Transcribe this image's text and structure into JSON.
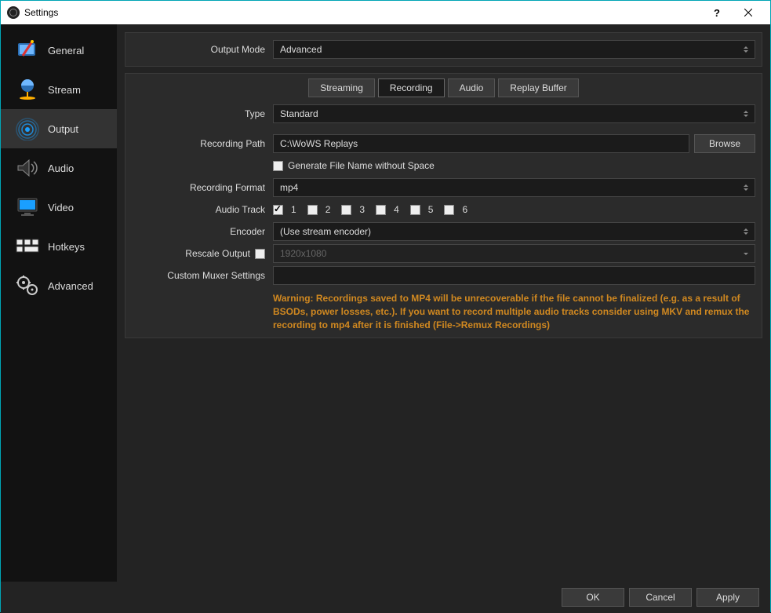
{
  "window": {
    "title": "Settings"
  },
  "sidebar": {
    "items": [
      {
        "label": "General"
      },
      {
        "label": "Stream"
      },
      {
        "label": "Output"
      },
      {
        "label": "Audio"
      },
      {
        "label": "Video"
      },
      {
        "label": "Hotkeys"
      },
      {
        "label": "Advanced"
      }
    ],
    "active_index": 2
  },
  "top": {
    "output_mode_label": "Output Mode",
    "output_mode_value": "Advanced"
  },
  "tabs": {
    "streaming": "Streaming",
    "recording": "Recording",
    "audio": "Audio",
    "replay_buffer": "Replay Buffer",
    "active": "recording"
  },
  "recording": {
    "type_label": "Type",
    "type_value": "Standard",
    "path_label": "Recording Path",
    "path_value": "C:\\WoWS Replays",
    "browse": "Browse",
    "gen_filename_checked": false,
    "gen_filename_label": "Generate File Name without Space",
    "format_label": "Recording Format",
    "format_value": "mp4",
    "audio_track_label": "Audio Track",
    "tracks": [
      {
        "num": "1",
        "checked": true
      },
      {
        "num": "2",
        "checked": false
      },
      {
        "num": "3",
        "checked": false
      },
      {
        "num": "4",
        "checked": false
      },
      {
        "num": "5",
        "checked": false
      },
      {
        "num": "6",
        "checked": false
      }
    ],
    "encoder_label": "Encoder",
    "encoder_value": "(Use stream encoder)",
    "rescale_label": "Rescale Output",
    "rescale_checked": false,
    "rescale_value": "1920x1080",
    "muxer_label": "Custom Muxer Settings",
    "muxer_value": "",
    "warning": "Warning: Recordings saved to MP4 will be unrecoverable if the file cannot be finalized (e.g. as a result of BSODs, power losses, etc.). If you want to record multiple audio tracks consider using MKV and remux the recording to mp4 after it is finished (File->Remux Recordings)"
  },
  "footer": {
    "ok": "OK",
    "cancel": "Cancel",
    "apply": "Apply"
  }
}
